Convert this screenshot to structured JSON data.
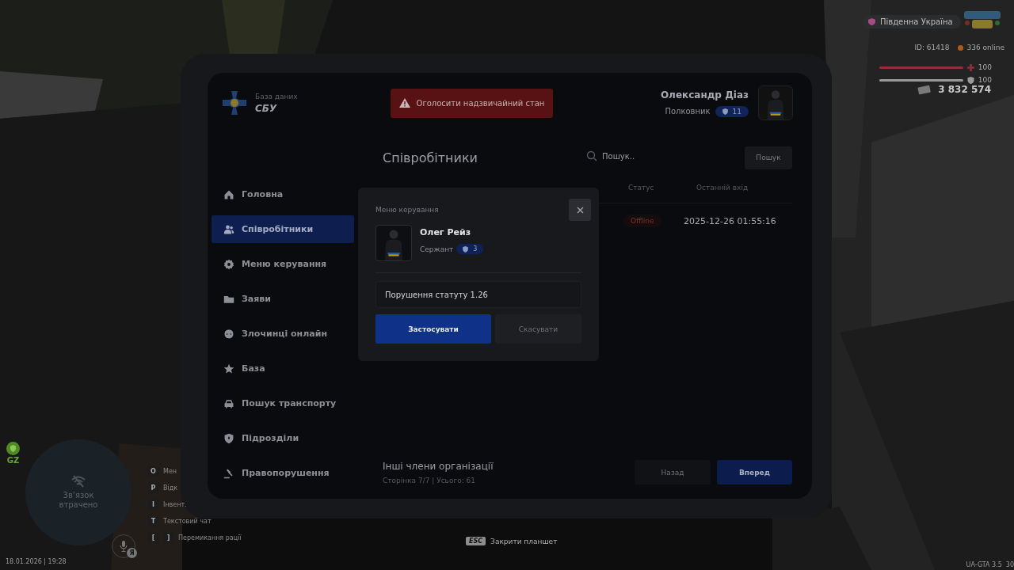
{
  "hud": {
    "server": "Південна Україна",
    "player_id": "ID: 61418",
    "online": "336 online",
    "health": {
      "level": 1,
      "value": "100"
    },
    "armor": {
      "level": 1,
      "value": "100"
    },
    "money": "3 832 574",
    "zone": "GZ",
    "radio_status": "Зв’язок втрачено",
    "voice_key": "Я",
    "datetime": "18.01.2026 | 19:28",
    "version": "UA-GTA 3.5",
    "fps": "30"
  },
  "keybinds": [
    {
      "keys": [
        "O"
      ],
      "label": "Мен"
    },
    {
      "keys": [
        "P"
      ],
      "label": "Відк"
    },
    {
      "keys": [
        "I"
      ],
      "label": "Інвент."
    },
    {
      "keys": [
        "T"
      ],
      "label": "Текстовий чат"
    },
    {
      "keys": [
        "[",
        "]"
      ],
      "label": "Перемикання рації"
    }
  ],
  "esc_hint": {
    "key": "ESC",
    "label": "Закрити планшет"
  },
  "tablet": {
    "brand": {
      "subtitle": "База даних",
      "title": "СБУ"
    },
    "emergency_button": "Оголосити надзвичайний стан",
    "user": {
      "name": "Олександр Діаз",
      "rank": "Полковник",
      "rank_level": "11"
    },
    "sidebar": [
      {
        "label": "Головна",
        "selected": false
      },
      {
        "label": "Співробітники",
        "selected": true
      },
      {
        "label": "Меню керування",
        "selected": false
      },
      {
        "label": "Заяви",
        "selected": false
      },
      {
        "label": "Злочинці онлайн",
        "selected": false
      },
      {
        "label": "База",
        "selected": false
      },
      {
        "label": "Пошук транспорту",
        "selected": false
      },
      {
        "label": "Підрозділи",
        "selected": false
      },
      {
        "label": "Правопорушення",
        "selected": false
      }
    ],
    "page_title": "Співробітники",
    "search": {
      "placeholder": "Пошук..",
      "button": "Пошук"
    },
    "table": {
      "columns": [
        "Статус",
        "Останній вхід"
      ],
      "rows": [
        {
          "status": "Offline",
          "last_login": "2025-12-26 01:55:16"
        }
      ]
    },
    "footer": {
      "title": "Інші члени організації",
      "page_info": "Сторінка 7/7 | Усього: 61",
      "prev_button": "Назад",
      "next_button": "Вперед"
    },
    "modal": {
      "title": "Меню керування",
      "name": "Олег Рейз",
      "rank": "Сержант",
      "rank_level": "3",
      "reason": "Порушення статуту 1.26",
      "apply_button": "Застосувати",
      "cancel_button": "Скасувати"
    }
  }
}
